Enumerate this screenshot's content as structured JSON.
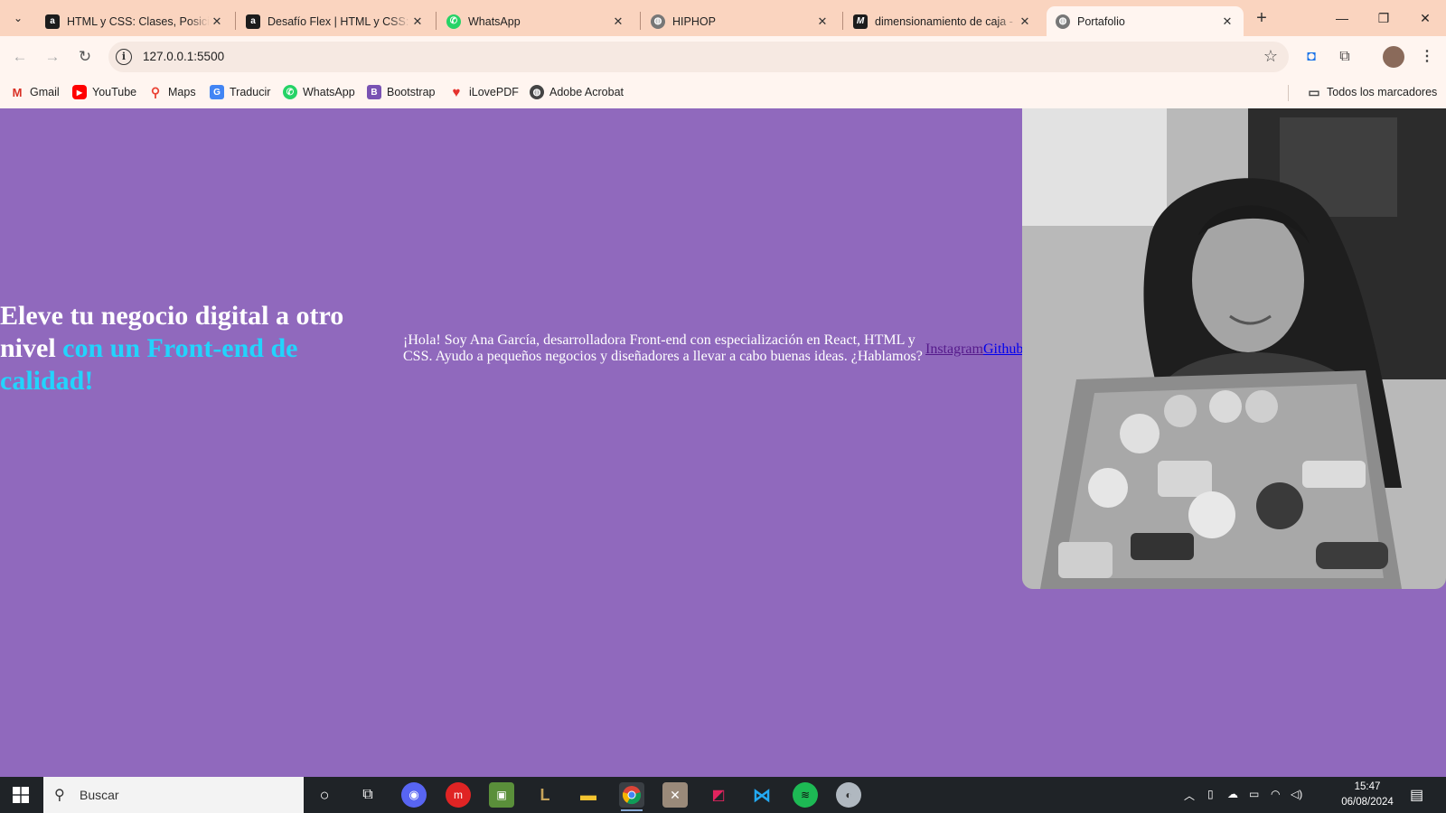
{
  "browser": {
    "tabs": [
      {
        "title": "HTML y CSS: Clases, Posicion",
        "icon": "alura-icon"
      },
      {
        "title": "Desafío Flex | HTML y CSS: Cl",
        "icon": "alura-icon"
      },
      {
        "title": "WhatsApp",
        "icon": "whatsapp-icon"
      },
      {
        "title": "HIPHOP",
        "icon": "globe-icon"
      },
      {
        "title": "dimensionamiento de caja -",
        "icon": "mdn-icon"
      },
      {
        "title": "Portafolio",
        "icon": "globe-icon",
        "active": true
      }
    ],
    "url": "127.0.0.1:5500",
    "bookmarks": [
      {
        "label": "Gmail",
        "icon": "gmail-icon"
      },
      {
        "label": "YouTube",
        "icon": "youtube-icon"
      },
      {
        "label": "Maps",
        "icon": "maps-icon"
      },
      {
        "label": "Traducir",
        "icon": "translate-icon"
      },
      {
        "label": "WhatsApp",
        "icon": "whatsapp-icon"
      },
      {
        "label": "Bootstrap",
        "icon": "bootstrap-icon"
      },
      {
        "label": "iLovePDF",
        "icon": "ilovepdf-icon"
      },
      {
        "label": "Adobe Acrobat",
        "icon": "acrobat-icon"
      }
    ],
    "all_bookmarks_label": "Todos los marcadores"
  },
  "page": {
    "headline_plain": "Eleve tu negocio digital a otro nivel ",
    "headline_highlight": "con un Front-end de calidad!",
    "intro": "¡Hola! Soy Ana García, desarrolladora Front-end con especialización en React, HTML y CSS. Ayudo a pequeños negocios y diseñadores a llevar a cabo buenas ideas. ¿Hablamos?",
    "links": {
      "instagram": "Instagram",
      "github": "Github"
    },
    "photo_description_icon": "profile-photo"
  },
  "taskbar": {
    "search_placeholder": "Buscar",
    "time": "15:47",
    "date": "06/08/2024"
  },
  "colors": {
    "page_background": "#9069bd",
    "headline_accent": "#22d4fd",
    "tab_strip": "#fad4bf"
  }
}
